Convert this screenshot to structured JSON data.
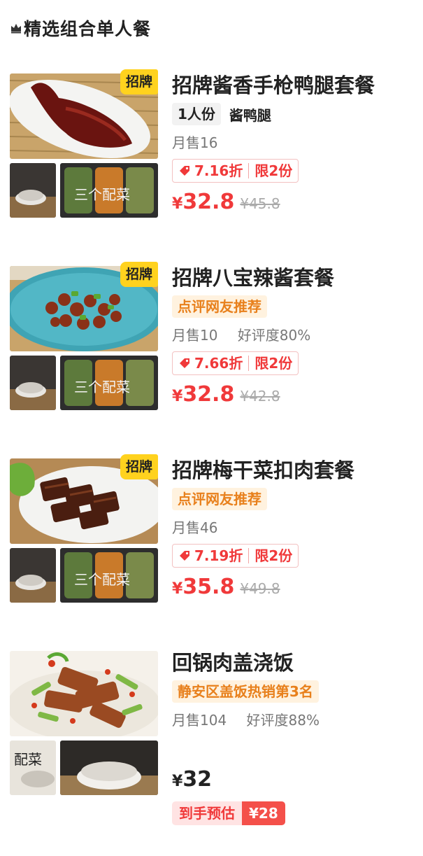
{
  "section": {
    "title": "精选组合单人餐",
    "icon": "crown-icon"
  },
  "colors": {
    "price_red": "#f0393a",
    "badge_yellow": "#ffd21e",
    "tag_orange": "#e8801c",
    "tag_orange_bg": "#fff2df"
  },
  "items": [
    {
      "badge": "招牌",
      "name": "招牌酱香手枪鸭腿套餐",
      "tag": "1人份",
      "tag_extra": "酱鸭腿",
      "sales": "月售16",
      "rating": "",
      "promo_discount": "7.16折",
      "promo_limit": "限2份",
      "price_symbol": "¥",
      "price": "32.8",
      "original_price": "¥45.8",
      "sub_image_text": "三个配菜"
    },
    {
      "badge": "招牌",
      "name": "招牌八宝辣酱套餐",
      "tag": "点评网友推荐",
      "sales": "月售10",
      "rating": "好评度80%",
      "promo_discount": "7.66折",
      "promo_limit": "限2份",
      "price_symbol": "¥",
      "price": "32.8",
      "original_price": "¥42.8",
      "sub_image_text": "三个配菜"
    },
    {
      "badge": "招牌",
      "name": "招牌梅干菜扣肉套餐",
      "tag": "点评网友推荐",
      "sales": "月售46",
      "rating": "",
      "promo_discount": "7.19折",
      "promo_limit": "限2份",
      "price_symbol": "¥",
      "price": "35.8",
      "original_price": "¥49.8",
      "sub_image_text": "三个配菜"
    },
    {
      "name": "回锅肉盖浇饭",
      "tag": "静安区盖饭热销第3名",
      "sales": "月售104",
      "rating": "好评度88%",
      "price_symbol": "¥",
      "price": "32",
      "estimate_label": "到手预估",
      "estimate_value": "¥28",
      "sub_image_text": "配菜"
    }
  ]
}
